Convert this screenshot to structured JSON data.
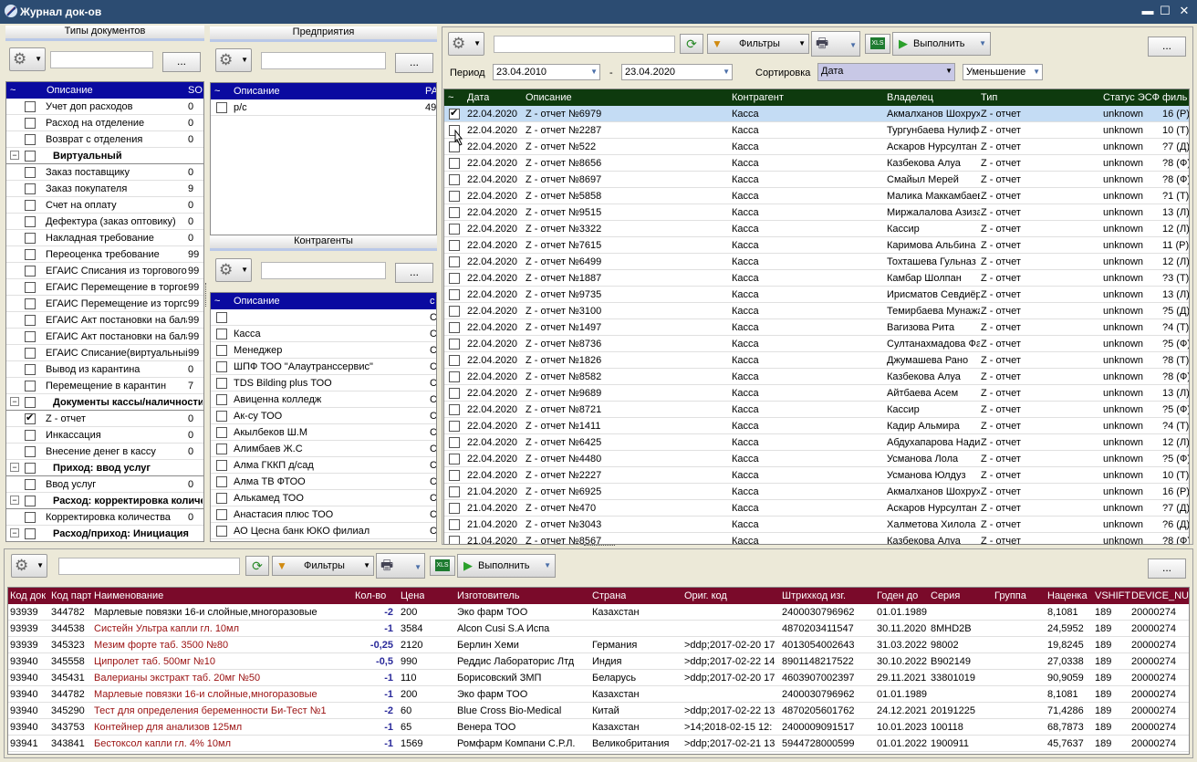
{
  "window": {
    "title": "Журнал док-ов",
    "min": "▬",
    "max": "☐",
    "close": "✕"
  },
  "doc_types": {
    "title": "Типы документов",
    "header_desc": "Описание",
    "header_code": "SO",
    "header_tilde": "~",
    "items": [
      {
        "label": "Учет доп расходов",
        "val": "0",
        "check": false,
        "group": false
      },
      {
        "label": "Расход на отделение",
        "val": "0",
        "check": false,
        "group": false
      },
      {
        "label": "Возврат с отделения",
        "val": "0",
        "check": false,
        "group": false
      },
      {
        "label": "Виртуальный",
        "val": "",
        "check": false,
        "group": true
      },
      {
        "label": "Заказ поставщику",
        "val": "0",
        "check": false,
        "group": false
      },
      {
        "label": "Заказ покупателя",
        "val": "9",
        "check": false,
        "group": false
      },
      {
        "label": "Счет на оплату",
        "val": "0",
        "check": false,
        "group": false
      },
      {
        "label": "Дефектура (заказ оптовику)",
        "val": "0",
        "check": false,
        "group": false
      },
      {
        "label": "Накладная требование",
        "val": "0",
        "check": false,
        "group": false
      },
      {
        "label": "Переоценка требование",
        "val": "99",
        "check": false,
        "group": false
      },
      {
        "label": "ЕГАИС Списания из торгового",
        "val": "99",
        "check": false,
        "group": false
      },
      {
        "label": "ЕГАИС Перемещение в торговый",
        "val": "99",
        "check": false,
        "group": false
      },
      {
        "label": "ЕГАИС Перемещение из торгового",
        "val": "99",
        "check": false,
        "group": false
      },
      {
        "label": "ЕГАИС Акт постановки на баланс",
        "val": "99",
        "check": false,
        "group": false
      },
      {
        "label": "ЕГАИС Акт постановки на баланс",
        "val": "99",
        "check": false,
        "group": false
      },
      {
        "label": "ЕГАИС Списание(виртуальный)",
        "val": "99",
        "check": false,
        "group": false
      },
      {
        "label": "Вывод из карантина",
        "val": "0",
        "check": false,
        "group": false
      },
      {
        "label": "Перемещение в карантин",
        "val": "7",
        "check": false,
        "group": false
      },
      {
        "label": "Документы кассы/наличности",
        "val": "",
        "check": false,
        "group": true
      },
      {
        "label": "Z - отчет",
        "val": "0",
        "check": true,
        "group": false
      },
      {
        "label": "Инкассация",
        "val": "0",
        "check": false,
        "group": false
      },
      {
        "label": "Внесение денег в кассу",
        "val": "0",
        "check": false,
        "group": false
      },
      {
        "label": "Приход: ввод услуг",
        "val": "",
        "check": false,
        "group": true
      },
      {
        "label": "Ввод услуг",
        "val": "0",
        "check": false,
        "group": false
      },
      {
        "label": "Расход: корректировка количества",
        "val": "",
        "check": false,
        "group": true
      },
      {
        "label": "Корректировка количества",
        "val": "0",
        "check": false,
        "group": false
      },
      {
        "label": "Расход/приход: Инициация",
        "val": "",
        "check": false,
        "group": true
      }
    ]
  },
  "enterprises": {
    "title": "Предприятия",
    "header_desc": "Описание",
    "header_code": "РА",
    "header_tilde": "~",
    "items": [
      {
        "label": "р/с",
        "val": "49"
      }
    ]
  },
  "contractors": {
    "title": "Контрагенты",
    "header_desc": "Описание",
    "header_code": "c",
    "header_tilde": "~",
    "items": [
      "",
      "Касса",
      "Менеджер",
      "ШПФ ТОО \"Алаутранссервис\"",
      "TDS Bilding plus ТОО",
      "Авиценна колледж",
      "Ак-су ТОО",
      "Акылбеков Ш.М",
      "Алимбаев Ж.С",
      "Алма ГККП д/сад",
      "Алма ТВ ФТОО",
      "Алькамед ТОО",
      "Анастасия плюс ТОО",
      "АО Цесна банк ЮКО филиал"
    ],
    "code": "С"
  },
  "toolbar": {
    "filters": "Фильтры",
    "execute": "Выполнить",
    "dots": "..."
  },
  "period": {
    "label": "Период",
    "from": "23.04.2010",
    "sep": "-",
    "to": "23.04.2020",
    "sort_label": "Сортировка",
    "sort_value": "Дата",
    "order_value": "Уменьшение"
  },
  "docs": {
    "headers": {
      "tilde": "~",
      "date": "Дата",
      "desc": "Описание",
      "contr": "Контрагент",
      "owner": "Владелец",
      "type": "Тип",
      "status": "Статус ЭСФ",
      "fil": "филь"
    },
    "rows": [
      {
        "date": "22.04.2020",
        "desc": "Z - отчет №6979",
        "contr": "Касса",
        "owner": "Акмалханов Шохрух",
        "type": "Z - отчет",
        "status": "unknown",
        "fil": "16 (Р)",
        "check": true,
        "sel": true
      },
      {
        "date": "22.04.2020",
        "desc": "Z - отчет №2287",
        "contr": "Касса",
        "owner": "Тургунбаева Нулифар",
        "type": "Z - отчет",
        "status": "unknown",
        "fil": "10 (Т)",
        "check": false,
        "sel": false
      },
      {
        "date": "22.04.2020",
        "desc": "Z - отчет №522",
        "contr": "Касса",
        "owner": "Аскаров Нурсултан",
        "type": "Z - отчет",
        "status": "unknown",
        "fil": "?7 (Д)",
        "check": false,
        "sel": false
      },
      {
        "date": "22.04.2020",
        "desc": "Z - отчет №8656",
        "contr": "Касса",
        "owner": "Казбекова Алуа",
        "type": "Z - отчет",
        "status": "unknown",
        "fil": "?8 (Ф)",
        "check": false,
        "sel": false
      },
      {
        "date": "22.04.2020",
        "desc": "Z - отчет №8697",
        "contr": "Касса",
        "owner": " Смайыл Мерей",
        "type": "Z - отчет",
        "status": "unknown",
        "fil": "?8 (Ф)",
        "check": false,
        "sel": false
      },
      {
        "date": "22.04.2020",
        "desc": "Z - отчет №5858",
        "contr": "Касса",
        "owner": "Малика Маккамбаева",
        "type": "Z - отчет",
        "status": "unknown",
        "fil": "?1 (Т)",
        "check": false,
        "sel": false
      },
      {
        "date": "22.04.2020",
        "desc": "Z - отчет №9515",
        "contr": "Касса",
        "owner": "Миржалалова Азиза",
        "type": "Z - отчет",
        "status": "unknown",
        "fil": "13 (Л)",
        "check": false,
        "sel": false
      },
      {
        "date": "22.04.2020",
        "desc": "Z - отчет №3322",
        "contr": "Касса",
        "owner": "Кассир",
        "type": "Z - отчет",
        "status": "unknown",
        "fil": "12 (Л)",
        "check": false,
        "sel": false
      },
      {
        "date": "22.04.2020",
        "desc": "Z - отчет №7615",
        "contr": "Касса",
        "owner": "Каримова Альбина",
        "type": "Z - отчет",
        "status": "unknown",
        "fil": "11 (Р)",
        "check": false,
        "sel": false
      },
      {
        "date": "22.04.2020",
        "desc": "Z - отчет №6499",
        "contr": "Касса",
        "owner": "Тохташева Гульназ",
        "type": "Z - отчет",
        "status": "unknown",
        "fil": "12 (Л)",
        "check": false,
        "sel": false
      },
      {
        "date": "22.04.2020",
        "desc": "Z - отчет №1887",
        "contr": "Касса",
        "owner": "Камбар Шолпан",
        "type": "Z - отчет",
        "status": "unknown",
        "fil": "?3 (Т)",
        "check": false,
        "sel": false
      },
      {
        "date": "22.04.2020",
        "desc": "Z - отчет №9735",
        "contr": "Касса",
        "owner": "Ирисматов Севдиёр",
        "type": "Z - отчет",
        "status": "unknown",
        "fil": "13 (Л)",
        "check": false,
        "sel": false
      },
      {
        "date": "22.04.2020",
        "desc": "Z - отчет №3100",
        "contr": "Касса",
        "owner": "Темирбаева Мунажат",
        "type": "Z - отчет",
        "status": "unknown",
        "fil": "?5 (Д)",
        "check": false,
        "sel": false
      },
      {
        "date": "22.04.2020",
        "desc": "Z - отчет №1497",
        "contr": "Касса",
        "owner": "Вагизова Рита",
        "type": "Z - отчет",
        "status": "unknown",
        "fil": "?4 (Т)",
        "check": false,
        "sel": false
      },
      {
        "date": "22.04.2020",
        "desc": "Z - отчет №8736",
        "contr": "Касса",
        "owner": "Султанахмадова Фатима",
        "type": "Z - отчет",
        "status": "unknown",
        "fil": "?5 (Ф)",
        "check": false,
        "sel": false
      },
      {
        "date": "22.04.2020",
        "desc": "Z - отчет №1826",
        "contr": "Касса",
        "owner": "Джумашева Рано",
        "type": "Z - отчет",
        "status": "unknown",
        "fil": "?8 (Т)",
        "check": false,
        "sel": false
      },
      {
        "date": "22.04.2020",
        "desc": "Z - отчет №8582",
        "contr": "Касса",
        "owner": "Казбекова Алуа",
        "type": "Z - отчет",
        "status": "unknown",
        "fil": "?8 (Ф)",
        "check": false,
        "sel": false
      },
      {
        "date": "22.04.2020",
        "desc": "Z - отчет №9689",
        "contr": "Касса",
        "owner": "Айтбаева Асем",
        "type": "Z - отчет",
        "status": "unknown",
        "fil": "13 (Л)",
        "check": false,
        "sel": false
      },
      {
        "date": "22.04.2020",
        "desc": "Z - отчет №8721",
        "contr": "Касса",
        "owner": "Кассир",
        "type": "Z - отчет",
        "status": "unknown",
        "fil": "?5 (Ф)",
        "check": false,
        "sel": false
      },
      {
        "date": "22.04.2020",
        "desc": "Z - отчет №1411",
        "contr": "Касса",
        "owner": "Кадир Альмира",
        "type": "Z - отчет",
        "status": "unknown",
        "fil": "?4 (Т)",
        "check": false,
        "sel": false
      },
      {
        "date": "22.04.2020",
        "desc": "Z - отчет №6425",
        "contr": "Касса",
        "owner": "Абдухапарова Надира",
        "type": "Z - отчет",
        "status": "unknown",
        "fil": "12 (Л)",
        "check": false,
        "sel": false
      },
      {
        "date": "22.04.2020",
        "desc": "Z - отчет №4480",
        "contr": "Касса",
        "owner": "Усманова Лола",
        "type": "Z - отчет",
        "status": "unknown",
        "fil": "?5 (Ф)",
        "check": false,
        "sel": false
      },
      {
        "date": "22.04.2020",
        "desc": "Z - отчет №2227",
        "contr": "Касса",
        "owner": "Усманова Юлдуз",
        "type": "Z - отчет",
        "status": "unknown",
        "fil": "10 (Т)",
        "check": false,
        "sel": false
      },
      {
        "date": "21.04.2020",
        "desc": "Z - отчет №6925",
        "contr": "Касса",
        "owner": "Акмалханов Шохрух",
        "type": "Z - отчет",
        "status": "unknown",
        "fil": "16 (Р)",
        "check": false,
        "sel": false
      },
      {
        "date": "21.04.2020",
        "desc": "Z - отчет №470",
        "contr": "Касса",
        "owner": "Аскаров Нурсултан",
        "type": "Z - отчет",
        "status": "unknown",
        "fil": "?7 (Д)",
        "check": false,
        "sel": false
      },
      {
        "date": "21.04.2020",
        "desc": "Z - отчет №3043",
        "contr": "Касса",
        "owner": "Халметова Хилола",
        "type": "Z - отчет",
        "status": "unknown",
        "fil": "?6 (Д)",
        "check": false,
        "sel": false
      },
      {
        "date": "21.04.2020",
        "desc": "Z - отчет №8567",
        "contr": "Касса",
        "owner": "Казбекова Алуа",
        "type": "Z - отчет",
        "status": "unknown",
        "fil": "?8 (Ф)",
        "check": false,
        "sel": false
      }
    ]
  },
  "items": {
    "headers": {
      "kod": "Код док",
      "part": "Код парт",
      "name": "Наименование",
      "qty": "Кол-во",
      "price": "Цена",
      "maker": "Изготовитель",
      "country": "Страна",
      "orig": "Ориг. код",
      "bar": "Штрихкод изг.",
      "till": "Годен до",
      "ser": "Серия",
      "group": "Группа",
      "markup": "Наценка",
      "vshift": "VSHIFT",
      "dev": "DEVICE_NUM"
    },
    "rows": [
      {
        "kod": "93939",
        "part": "344782",
        "name": "Марлевые повязки 16-и слойные,многоразовые",
        "qty": "-2",
        "price": "200",
        "maker": "Эко фарм ТОО",
        "country": "Казахстан",
        "orig": "",
        "bar": "2400030796962",
        "till": "01.01.1989",
        "ser": "",
        "group": "",
        "markup": "8,1081",
        "vshift": "189",
        "dev": "20000274",
        "red": false
      },
      {
        "kod": "93939",
        "part": "344538",
        "name": "Систейн Ультра капли гл. 10мл",
        "qty": "-1",
        "price": "3584",
        "maker": "Alcon Cusi S.A  Испа",
        "country": "",
        "orig": "",
        "bar": "4870203411547",
        "till": "30.11.2020",
        "ser": "8MHD2B",
        "group": "",
        "markup": "24,5952",
        "vshift": "189",
        "dev": "20000274",
        "red": true
      },
      {
        "kod": "93939",
        "part": "345323",
        "name": "Мезим форте таб. 3500 №80",
        "qty": "-0,25",
        "price": "2120",
        "maker": "Берлин Хеми",
        "country": "Германия",
        "orig": ">ddp;2017-02-20 17",
        "bar": "4013054002643",
        "till": "31.03.2022",
        "ser": "98002",
        "group": "",
        "markup": "19,8245",
        "vshift": "189",
        "dev": "20000274",
        "red": true
      },
      {
        "kod": "93940",
        "part": "345558",
        "name": "Ципролет таб. 500мг №10",
        "qty": "-0,5",
        "price": "990",
        "maker": "Реддис Лабораторис Лтд",
        "country": "Индия",
        "orig": ">ddp;2017-02-22 14",
        "bar": "8901148217522",
        "till": "30.10.2022",
        "ser": "B902149",
        "group": "",
        "markup": "27,0338",
        "vshift": "189",
        "dev": "20000274",
        "red": true
      },
      {
        "kod": "93940",
        "part": "345431",
        "name": "Валерианы экстракт таб. 20мг №50",
        "qty": "-1",
        "price": "110",
        "maker": "Борисовский ЗМП",
        "country": "Беларусь",
        "orig": ">ddp;2017-02-20 17",
        "bar": "4603907002397",
        "till": "29.11.2021",
        "ser": "33801019",
        "group": "",
        "markup": "90,9059",
        "vshift": "189",
        "dev": "20000274",
        "red": true
      },
      {
        "kod": "93940",
        "part": "344782",
        "name": "Марлевые повязки 16-и слойные,многоразовые",
        "qty": "-1",
        "price": "200",
        "maker": "Эко фарм ТОО",
        "country": "Казахстан",
        "orig": "",
        "bar": "2400030796962",
        "till": "01.01.1989",
        "ser": "",
        "group": "",
        "markup": "8,1081",
        "vshift": "189",
        "dev": "20000274",
        "red": true
      },
      {
        "kod": "93940",
        "part": "345290",
        "name": "Тест для определения беременности Би-Тест №1",
        "qty": "-2",
        "price": "60",
        "maker": "Blue Cross Bio-Medical",
        "country": "Китай",
        "orig": ">ddp;2017-02-22 13",
        "bar": "4870205601762",
        "till": "24.12.2021",
        "ser": "20191225",
        "group": "",
        "markup": "71,4286",
        "vshift": "189",
        "dev": "20000274",
        "red": true
      },
      {
        "kod": "93940",
        "part": "343753",
        "name": "Контейнер для анализов 125мл",
        "qty": "-1",
        "price": "65",
        "maker": "Венера ТОО",
        "country": "Казахстан",
        "orig": ">14;2018-02-15 12:",
        "bar": "2400009091517",
        "till": "10.01.2023",
        "ser": "100118",
        "group": "",
        "markup": "68,7873",
        "vshift": "189",
        "dev": "20000274",
        "red": true
      },
      {
        "kod": "93941",
        "part": "343841",
        "name": "Бестоксол капли гл. 4% 10мл",
        "qty": "-1",
        "price": "1569",
        "maker": "Ромфарм Компани С.Р.Л.",
        "country": "Великобритания",
        "orig": ">ddp;2017-02-21 13",
        "bar": "5944728000599",
        "till": "01.01.2022",
        "ser": "1900911",
        "group": "",
        "markup": "45,7637",
        "vshift": "189",
        "dev": "20000274",
        "red": true
      }
    ]
  }
}
